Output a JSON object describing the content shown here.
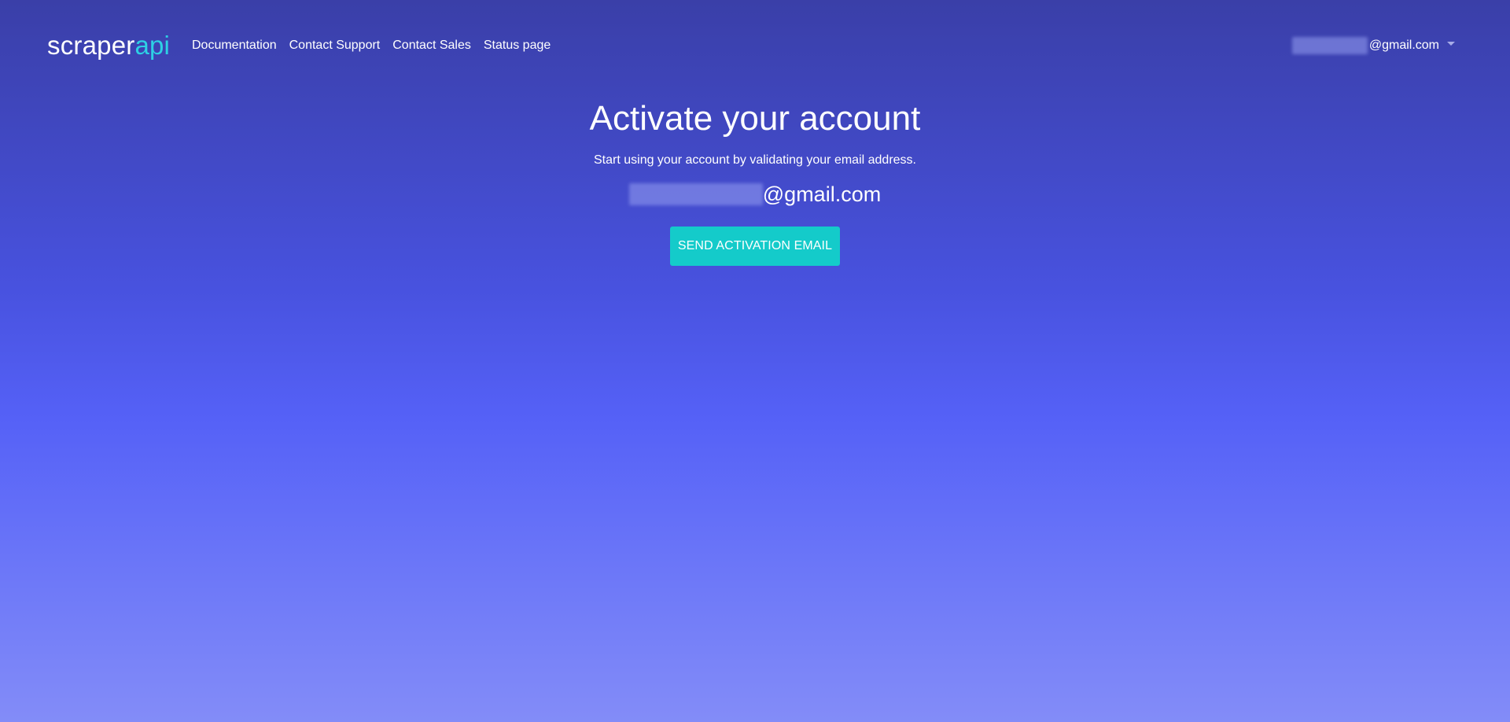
{
  "brand": {
    "name_part1": "scraper",
    "name_part2": "api",
    "accent_color": "#2dd0e4"
  },
  "nav": {
    "links": [
      {
        "label": "Documentation"
      },
      {
        "label": "Contact Support"
      },
      {
        "label": "Contact Sales"
      },
      {
        "label": "Status page"
      }
    ]
  },
  "user": {
    "email_visible": "@gmail.com",
    "menu_icon": "chevron-down-icon"
  },
  "main": {
    "title": "Activate your account",
    "subtitle": "Start using your account by validating your email address.",
    "email_visible": "@gmail.com",
    "button_label": "SEND ACTIVATION EMAIL",
    "button_color": "#14cbca"
  },
  "colors": {
    "background_top": "#3a3fa8",
    "background_bottom": "#838cf8"
  }
}
